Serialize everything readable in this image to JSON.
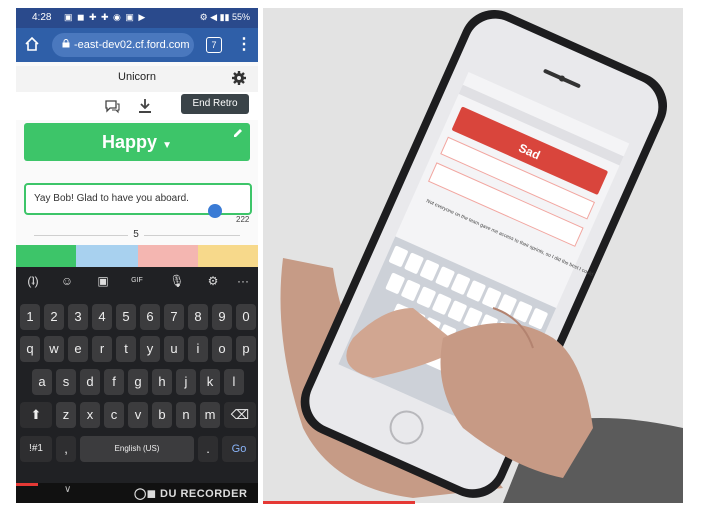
{
  "status_bar": {
    "time": "4:28",
    "battery": "55%"
  },
  "browser": {
    "url": "-east-dev02.cf.ford.com",
    "tab_count": "7"
  },
  "app": {
    "title": "Unicorn",
    "end_retro_label": "End Retro",
    "column_title": "Happy",
    "column_color": "#3dc569",
    "thought_text": "Yay Bob! Glad to have you aboard.",
    "char_count": "222",
    "count": "5",
    "column_colors": [
      "#3dc569",
      "#a8d1ef",
      "#f4b6b1",
      "#f7d98b"
    ]
  },
  "keyboard": {
    "number_row": [
      "1",
      "2",
      "3",
      "4",
      "5",
      "6",
      "7",
      "8",
      "9",
      "0"
    ],
    "row1": [
      "q",
      "w",
      "e",
      "r",
      "t",
      "y",
      "u",
      "i",
      "o",
      "p"
    ],
    "row2": [
      "a",
      "s",
      "d",
      "f",
      "g",
      "h",
      "j",
      "k",
      "l"
    ],
    "row3": [
      "z",
      "x",
      "c",
      "v",
      "b",
      "n",
      "m"
    ],
    "symbols_label": "!#1",
    "comma": ",",
    "space_label": "English (US)",
    "period": ".",
    "go_label": "Go",
    "gif_label": "GIF"
  },
  "recorder": {
    "badge": "DU RECORDER"
  },
  "photo": {
    "phone_column_title": "Sad",
    "phone_text": "Not everyone on the team gave me access to their sprints, so I did the best I could"
  }
}
